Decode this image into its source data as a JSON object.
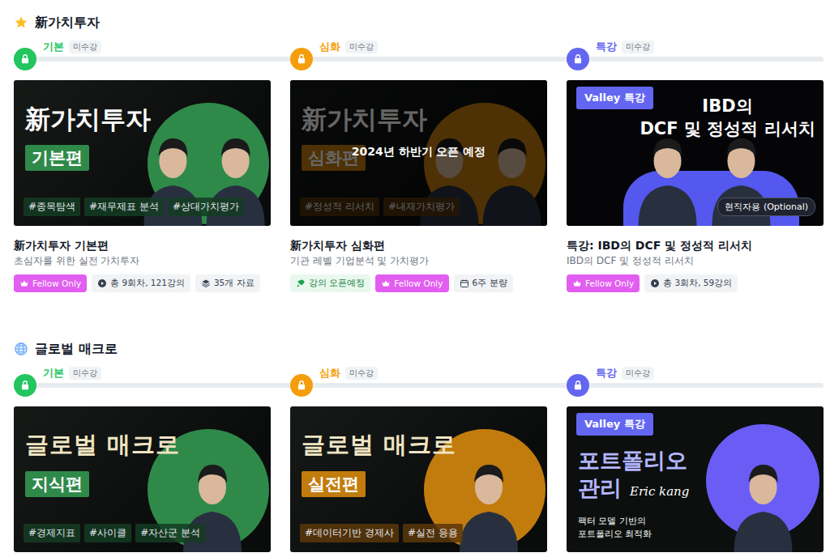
{
  "sections": [
    {
      "title": "新가치투자",
      "courses": [
        {
          "level": "기본",
          "color": "#22c55e",
          "status": "미수강",
          "locked": true,
          "thumb": {
            "kind": "series",
            "title": "新가치투자",
            "subtitle": "기본편",
            "color": "#2f8a4a",
            "title_color": "#ffffff",
            "hashtags": [
              "#종목탐색",
              "#재무제표 분석",
              "#상대가치평가"
            ],
            "dimmed": false
          },
          "name": "新가치투자 기본편",
          "desc": "초심자를 위한 실전 가치투자",
          "tags": [
            {
              "label": "Fellow Only",
              "kind": "fellow"
            },
            {
              "label": "총 9회차, 121강의",
              "kind": "lessons"
            },
            {
              "label": "35개 자료",
              "kind": "materials"
            }
          ]
        },
        {
          "level": "심화",
          "color": "#f59e0b",
          "status": "미수강",
          "locked": true,
          "thumb": {
            "kind": "series",
            "title": "新가치투자",
            "subtitle": "심화편",
            "color": "#c27c0e",
            "title_color": "#ffffff",
            "hashtags": [
              "#정성적 리서치",
              "#내재가치평가"
            ],
            "dimmed": true,
            "overlay": "2024년 하반기 오픈 예정"
          },
          "name": "新가치투자 심화편",
          "desc": "기관 레벨 기업분석 및 가치평가",
          "tags": [
            {
              "label": "강의 오픈예정",
              "kind": "opening"
            },
            {
              "label": "Fellow Only",
              "kind": "fellow"
            },
            {
              "label": "6주 분량",
              "kind": "duration"
            }
          ]
        },
        {
          "level": "특강",
          "color": "#6366f1",
          "status": "미수강",
          "locked": true,
          "thumb": {
            "kind": "special",
            "badge": "Valley 특강",
            "title_lines": [
              "IBD의",
              "DCF 및 정성적 리서치"
            ],
            "note": "현직자용 (Optional)",
            "color": "#5458ee"
          },
          "name": "특강: IBD의 DCF 및 정성적 리서치",
          "desc": "IBD의 DCF 및 정성적 리서치",
          "tags": [
            {
              "label": "Fellow Only",
              "kind": "fellow"
            },
            {
              "label": "총 3회차, 59강의",
              "kind": "lessons"
            }
          ]
        }
      ]
    },
    {
      "title": "글로벌 매크로",
      "courses": [
        {
          "level": "기본",
          "color": "#22c55e",
          "status": "미수강",
          "locked": true,
          "thumb": {
            "kind": "series",
            "title": "글로벌 매크로",
            "subtitle": "지식편",
            "color": "#2f8a4a",
            "title_color": "#efe4c2",
            "hashtags": [
              "#경제지표",
              "#사이클",
              "#자산군 분석"
            ],
            "dimmed": false
          }
        },
        {
          "level": "심화",
          "color": "#f59e0b",
          "status": "미수강",
          "locked": true,
          "thumb": {
            "kind": "series",
            "title": "글로벌 매크로",
            "subtitle": "실전편",
            "color": "#c27c0e",
            "title_color": "#efe4c2",
            "hashtags": [
              "#데이터기반 경제사",
              "#실전 응용"
            ],
            "dimmed": false
          }
        },
        {
          "level": "특강",
          "color": "#6366f1",
          "status": "미수강",
          "locked": true,
          "thumb": {
            "kind": "portfolio",
            "badge": "Valley 특강",
            "title_lines": [
              "포트폴리오",
              "관리"
            ],
            "signature": "Eric kang",
            "sub_lines": [
              "팩터 모델 기반의",
              "포트폴리오 최적화"
            ],
            "color": "#6b5cf6"
          }
        }
      ]
    }
  ]
}
